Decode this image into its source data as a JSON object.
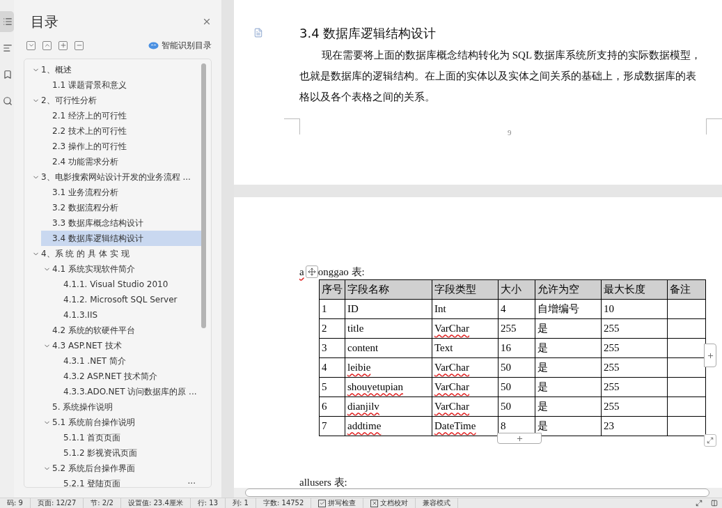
{
  "rail": {
    "items": [
      {
        "kind": "toc",
        "selected": true
      },
      {
        "kind": "outline",
        "selected": false
      },
      {
        "kind": "bookmark",
        "selected": false
      },
      {
        "kind": "search",
        "selected": false
      }
    ]
  },
  "toc": {
    "title": "目录",
    "smart_label": "智能识别目录",
    "items": [
      {
        "label": "1、概述",
        "expanded": true,
        "selected": false,
        "children": [
          {
            "label": "1.1 课题背景和意义",
            "selected": false
          }
        ]
      },
      {
        "label": "2、可行性分析",
        "expanded": true,
        "selected": false,
        "children": [
          {
            "label": "2.1 经济上的可行性",
            "selected": false
          },
          {
            "label": "2.2 技术上的可行性",
            "selected": false
          },
          {
            "label": "2.3 操作上的可行性",
            "selected": false
          },
          {
            "label": "2.4 功能需求分析",
            "selected": false
          }
        ]
      },
      {
        "label": "3、电影搜索网站设计开发的业务流程 ...",
        "expanded": true,
        "selected": false,
        "children": [
          {
            "label": "3.1 业务流程分析",
            "selected": false
          },
          {
            "label": "3.2 数据流程分析",
            "selected": false
          },
          {
            "label": "3.3 数据库概念结构设计",
            "selected": false
          },
          {
            "label": "3.4 数据库逻辑结构设计",
            "selected": true
          }
        ]
      },
      {
        "label": "4、系 统 的 具 体 实 现",
        "expanded": true,
        "selected": false,
        "children": [
          {
            "label": "4.1  系统实现软件简介",
            "expanded": true,
            "selected": false,
            "children": [
              {
                "label": "4.1.1. Visual Studio 2010",
                "selected": false
              },
              {
                "label": "4.1.2. Microsoft  SQL Server",
                "selected": false
              },
              {
                "label": "4.1.3.IIS",
                "selected": false
              }
            ]
          },
          {
            "label": "4.2 系统的软硬件平台",
            "selected": false
          },
          {
            "label": "4.3 ASP.NET 技术",
            "expanded": true,
            "selected": false,
            "children": [
              {
                "label": "4.3.1 .NET 简介",
                "selected": false
              },
              {
                "label": "4.3.2 ASP.NET 技术简介",
                "selected": false
              },
              {
                "label": "4.3.3.ADO.NET 访问数据库的原 ...",
                "selected": false
              }
            ]
          },
          {
            "label": "5.  系统操作说明",
            "selected": false
          },
          {
            "label": "5.1 系统前台操作说明",
            "expanded": true,
            "selected": false,
            "children": [
              {
                "label": "5.1.1 首页页面",
                "selected": false
              },
              {
                "label": "5.1.2 影视资讯页面",
                "selected": false
              }
            ]
          },
          {
            "label": "5.2 系统后台操作界面",
            "expanded": true,
            "selected": false,
            "children": [
              {
                "label": "5.2.1 登陆页面",
                "selected": false
              }
            ]
          }
        ]
      }
    ],
    "more": "..."
  },
  "page1": {
    "heading": "3.4 数据库逻辑结构设计",
    "paragraph": "现在需要将上面的数据库概念结构转化为 SQL 数据库系统所支持的实际数据模型，也就是数据库的逻辑结构。在上面的实体以及实体之间关系的基础上，形成数据库的表格以及各个表格之间的关系。",
    "page_number": "9"
  },
  "page2": {
    "table_label_start": "a",
    "table_label_end": "onggao 表:",
    "table": {
      "columns": [
        "序号",
        "字段名称",
        "字段类型",
        "大小",
        "允许为空",
        "最大长度",
        "备注"
      ],
      "rows": [
        [
          {
            "text": "1",
            "misspelled": false
          },
          {
            "text": "ID",
            "misspelled": false
          },
          {
            "text": "Int",
            "misspelled": false
          },
          {
            "text": "4",
            "misspelled": false
          },
          {
            "text": "自增编号",
            "misspelled": false
          },
          {
            "text": "10",
            "misspelled": false
          }
        ],
        [
          {
            "text": "2",
            "misspelled": false
          },
          {
            "text": "title",
            "misspelled": false
          },
          {
            "text": "VarChar",
            "misspelled": true
          },
          {
            "text": "255",
            "misspelled": false
          },
          {
            "text": "是",
            "misspelled": false
          },
          {
            "text": "255",
            "misspelled": false
          }
        ],
        [
          {
            "text": "3",
            "misspelled": false
          },
          {
            "text": "content",
            "misspelled": false
          },
          {
            "text": "Text",
            "misspelled": false
          },
          {
            "text": "16",
            "misspelled": false
          },
          {
            "text": "是",
            "misspelled": false
          },
          {
            "text": "255",
            "misspelled": false
          }
        ],
        [
          {
            "text": "4",
            "misspelled": false
          },
          {
            "text": "leibie",
            "misspelled": true
          },
          {
            "text": "VarChar",
            "misspelled": true
          },
          {
            "text": "50",
            "misspelled": false
          },
          {
            "text": "是",
            "misspelled": false
          },
          {
            "text": "255",
            "misspelled": false
          }
        ],
        [
          {
            "text": "5",
            "misspelled": false
          },
          {
            "text": "shouyetupian",
            "misspelled": true
          },
          {
            "text": "VarChar",
            "misspelled": true
          },
          {
            "text": "50",
            "misspelled": false
          },
          {
            "text": "是",
            "misspelled": false
          },
          {
            "text": "255",
            "misspelled": false
          }
        ],
        [
          {
            "text": "6",
            "misspelled": false
          },
          {
            "text": "dianjilv",
            "misspelled": true
          },
          {
            "text": "VarChar",
            "misspelled": true
          },
          {
            "text": "50",
            "misspelled": false
          },
          {
            "text": "是",
            "misspelled": false
          },
          {
            "text": "255",
            "misspelled": false
          }
        ],
        [
          {
            "text": "7",
            "misspelled": false
          },
          {
            "text": "addtime",
            "misspelled": true
          },
          {
            "text": "DateTime",
            "misspelled": true
          },
          {
            "text": "8",
            "misspelled": false
          },
          {
            "text": "是",
            "misspelled": false
          },
          {
            "text": "23",
            "misspelled": false
          }
        ]
      ]
    },
    "next_label": "allusers 表:"
  },
  "status_bar": [
    {
      "kind": "text",
      "label": "码: 9"
    },
    {
      "kind": "text",
      "label": "页面: 12/27"
    },
    {
      "kind": "text",
      "label": "节: 2/2"
    },
    {
      "kind": "text",
      "label": "设置值: 23.4厘米"
    },
    {
      "kind": "text",
      "label": "行: 13"
    },
    {
      "kind": "text",
      "label": "列: 1"
    },
    {
      "kind": "text",
      "label": "字数: 14752"
    },
    {
      "kind": "check",
      "label": "拼写检查",
      "checked": true
    },
    {
      "kind": "check",
      "label": "文档校对",
      "checked": false
    },
    {
      "kind": "text",
      "label": "兼容模式"
    }
  ]
}
